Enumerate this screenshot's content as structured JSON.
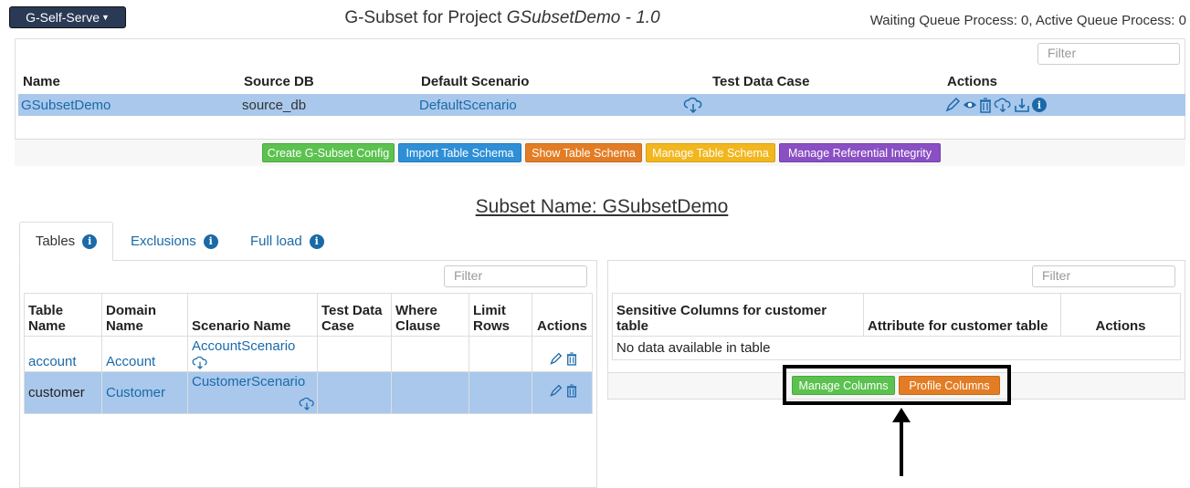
{
  "header": {
    "menu_label": "G-Self-Serve",
    "title_prefix": "G-Subset for Project ",
    "title_project": "GSubsetDemo - 1.0",
    "queue_status": "Waiting Queue Process: 0, Active Queue Process: 0"
  },
  "projects": {
    "filter_placeholder": "Filter",
    "columns": [
      "Name",
      "Source DB",
      "Default Scenario",
      "Test Data Case",
      "Actions"
    ],
    "rows": [
      {
        "name": "GSubsetDemo",
        "source_db": "source_db",
        "default_scenario": "DefaultScenario"
      }
    ],
    "buttons": {
      "create": "Create G-Subset Config",
      "import": "Import Table Schema",
      "show": "Show Table Schema",
      "manage": "Manage Table Schema",
      "integrity": "Manage Referential Integrity"
    }
  },
  "subset": {
    "heading": "Subset Name: GSubsetDemo",
    "tabs": [
      "Tables",
      "Exclusions",
      "Full load"
    ],
    "active_tab": "Tables"
  },
  "tables": {
    "filter_placeholder": "Filter",
    "columns": [
      "Table Name",
      "Domain Name",
      "Scenario Name",
      "Test Data Case",
      "Where Clause",
      "Limit Rows",
      "Actions"
    ],
    "rows": [
      {
        "table": "account",
        "domain": "Account",
        "scenario": "AccountScenario"
      },
      {
        "table": "customer",
        "domain": "Customer",
        "scenario": "CustomerScenario"
      }
    ]
  },
  "columns_panel": {
    "filter_placeholder": "Filter",
    "columns": [
      "Sensitive Columns for customer table",
      "Attribute for customer table",
      "Actions"
    ],
    "empty_text": "No data available in table",
    "buttons": {
      "manage": "Manage Columns",
      "profile": "Profile Columns"
    }
  },
  "colors": {
    "selected_row": "#a9c8ec",
    "link": "#1a6aa8",
    "highlight_box": "#000000"
  }
}
